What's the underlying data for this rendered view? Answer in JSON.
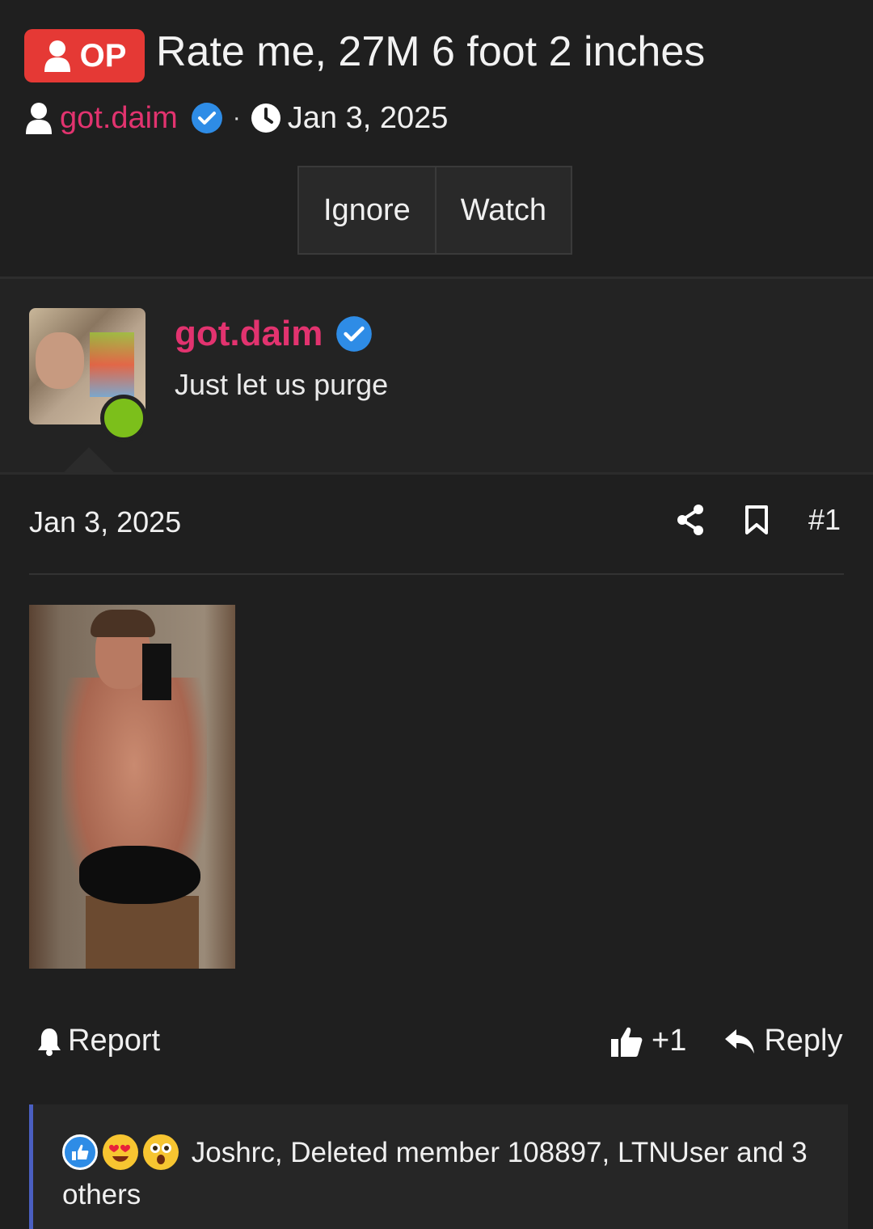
{
  "thread": {
    "op_badge": "OP",
    "title": "Rate me, 27M 6 foot 2 inches",
    "author": "got.daim",
    "separator": "·",
    "date": "Jan 3, 2025"
  },
  "thread_buttons": {
    "ignore": "Ignore",
    "watch": "Watch"
  },
  "post": {
    "author": "got.daim",
    "user_title": "Just let us purge",
    "date": "Jan 3, 2025",
    "post_number": "#1",
    "report": "Report",
    "like_count": "+1",
    "reply": "Reply"
  },
  "reactions": {
    "icons": [
      "like-emoji",
      "heart-eyes-emoji",
      "astonished-emoji"
    ],
    "text": "Joshrc, Deleted member 108897, LTNUser and 3 others"
  },
  "colors": {
    "background": "#1f1f1f",
    "op_badge": "#e53935",
    "username": "#e2336f",
    "verified": "#2e8ce6",
    "online": "#7cbf1b",
    "reaction_border": "#4a5fc1"
  }
}
